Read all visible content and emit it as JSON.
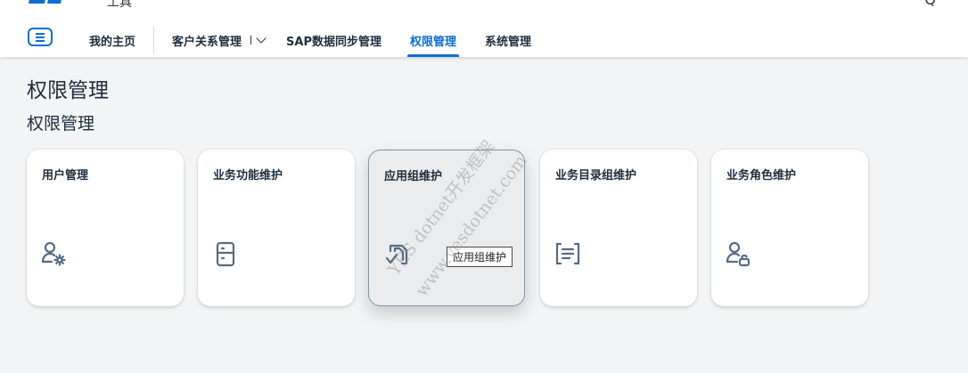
{
  "header": {
    "logo": "logo",
    "title": "工具",
    "right_glyph": "Q",
    "menu_icon": "hamburger-menu-icon",
    "nav": [
      {
        "label": "我的主页"
      },
      {
        "label": "客户关系管理"
      },
      {
        "label": "SAP数据同步管理"
      },
      {
        "label": "权限管理",
        "active": true
      },
      {
        "label": "系统管理"
      }
    ],
    "accent_color": "#0a6ed1"
  },
  "page": {
    "title": "权限管理",
    "section_title": "权限管理"
  },
  "tiles": [
    {
      "label": "用户管理",
      "icon": "user-settings-icon"
    },
    {
      "label": "业务功能维护",
      "icon": "document-icon"
    },
    {
      "label": "应用组维护",
      "icon": "approvals-icon",
      "hovered": true
    },
    {
      "label": "业务目录组维护",
      "icon": "list-icon"
    },
    {
      "label": "业务角色维护",
      "icon": "user-lock-icon"
    }
  ],
  "tooltip": "应用组维护",
  "watermark": {
    "line1": "YES dotnet开发框架",
    "line2": "www.yesdotnet.com"
  }
}
